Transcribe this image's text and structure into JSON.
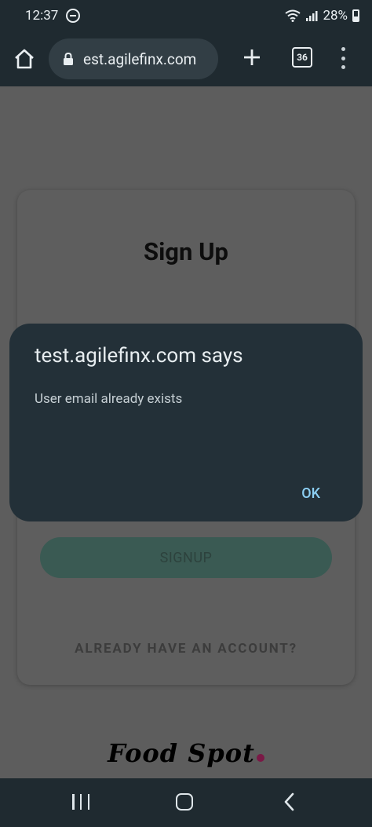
{
  "status_bar": {
    "time": "12:37",
    "battery": "28%"
  },
  "browser": {
    "url": "est.agilefinx.com",
    "tab_count": "36"
  },
  "page": {
    "title": "Sign Up",
    "signup_button": "SIGNUP",
    "login_link": "ALREADY HAVE AN ACCOUNT?",
    "logo_text": "Food Spot",
    "logo_dot_color": "#7a1946"
  },
  "dialog": {
    "title": "test.agilefinx.com says",
    "message": "User email already exists",
    "ok_label": "OK"
  },
  "icons": {
    "status": [
      "dnd-icon",
      "wifi-icon",
      "signal-icon",
      "battery-icon"
    ],
    "toolbar": [
      "home-icon",
      "lock-icon",
      "plus-icon",
      "tab-switcher-icon",
      "overflow-menu-icon"
    ],
    "nav": [
      "recents-icon",
      "home-nav-icon",
      "back-icon"
    ]
  }
}
